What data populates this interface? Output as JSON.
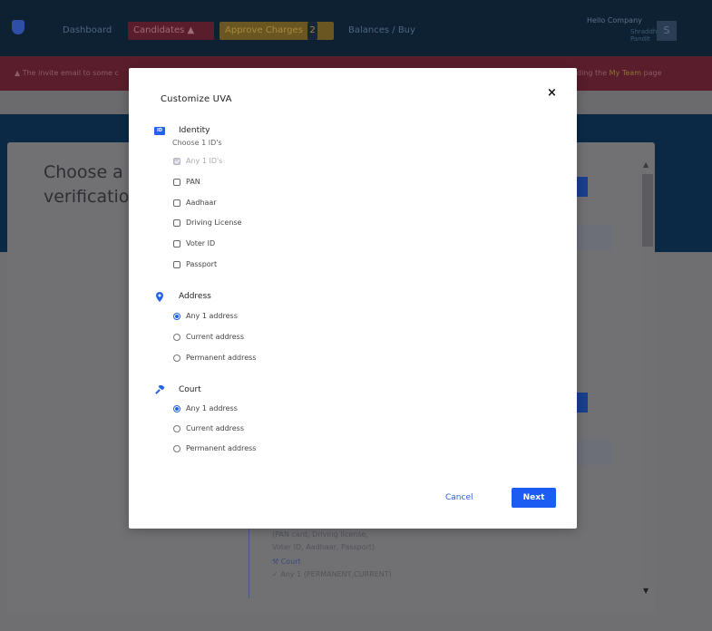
{
  "topbar": {
    "nav": {
      "dashboard": "Dashboard",
      "candidates": "Candidates",
      "candidates_icon": "warning-icon",
      "approve_charges": "Approve Charges",
      "approve_badge": "2",
      "balances": "Balances / Buy"
    },
    "user": {
      "greeting": "Hello Company",
      "name": "Shraddha Pandit",
      "avatar_letter": "S"
    }
  },
  "alert": {
    "icon": "warning-icon",
    "text": "The invite email to some c",
    "text_right_prefix": "ding the",
    "link": "My Team",
    "text_right_suffix": "page"
  },
  "main": {
    "heading_line1": "Choose a",
    "heading_line2": "verificatio",
    "summary_line1": "(PAN card, Driving license,",
    "summary_line2": "Voter ID, Aadhaar, Passport)",
    "summary_court": "Court",
    "summary_court_value": "Any 1 (PERMANENT,CURRENT)"
  },
  "modal": {
    "title": "Customize UVA",
    "close_label": "×",
    "identity": {
      "label": "Identity",
      "icon": "id-card-icon",
      "icon_text": "ID",
      "subtitle": "Choose 1 ID's",
      "options": [
        "Any 1 ID's",
        "PAN",
        "Aadhaar",
        "Driving License",
        "Voter ID",
        "Passport"
      ],
      "checked": [
        true,
        false,
        false,
        false,
        false,
        false
      ]
    },
    "address": {
      "label": "Address",
      "icon": "map-pin-icon",
      "options": [
        "Any 1 address",
        "Current address",
        "Permanent address"
      ],
      "selected": 0
    },
    "court": {
      "label": "Court",
      "icon": "gavel-icon",
      "options": [
        "Any 1 address",
        "Current address",
        "Permanent address"
      ],
      "selected": 0
    },
    "cancel_label": "Cancel",
    "next_label": "Next"
  },
  "colors": {
    "accent": "#1d5cf2",
    "topbar": "#0d2133",
    "alert": "#5a1d2c",
    "hero": "#0b2945"
  }
}
